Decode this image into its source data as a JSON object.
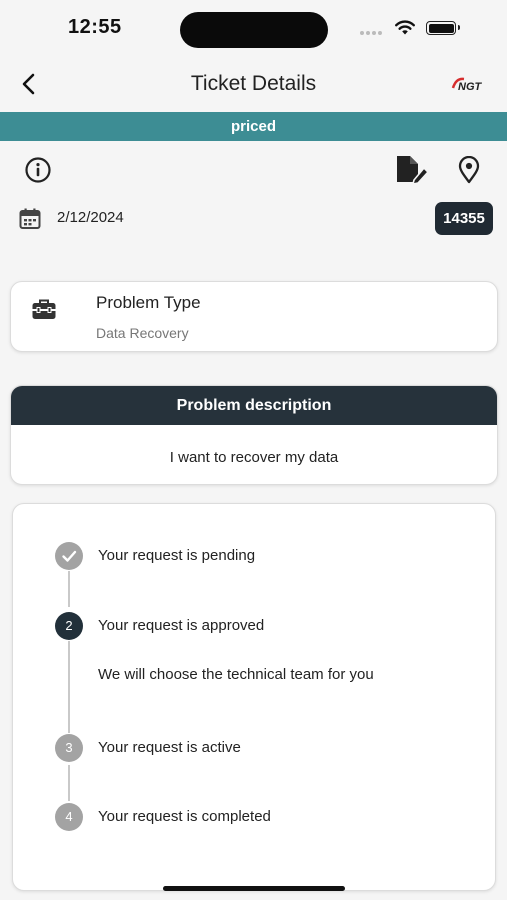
{
  "status_bar": {
    "time": "12:55"
  },
  "nav": {
    "title": "Ticket Details",
    "logo_text": "NGT"
  },
  "status_banner": {
    "text": "priced",
    "color": "#3d8d94"
  },
  "ticket": {
    "date": "2/12/2024",
    "number": "14355"
  },
  "problem_type": {
    "title": "Problem Type",
    "value": "Data Recovery"
  },
  "description": {
    "header": "Problem description",
    "text": "I want to recover my data"
  },
  "timeline": {
    "steps": [
      {
        "marker": "",
        "label": "Your request is pending",
        "state": "done"
      },
      {
        "marker": "2",
        "label": "Your request is approved",
        "state": "current",
        "note": "We will choose the technical team for you"
      },
      {
        "marker": "3",
        "label": "Your request is active",
        "state": "upcoming"
      },
      {
        "marker": "4",
        "label": "Your request is completed",
        "state": "upcoming"
      }
    ]
  },
  "colors": {
    "accent": "#3d8d94",
    "dark": "#22303a",
    "muted": "#a3a3a3"
  },
  "icons": [
    "back-chevron-icon",
    "info-icon",
    "edit-document-icon",
    "location-pin-icon",
    "calendar-icon",
    "toolbox-icon",
    "checkmark-icon"
  ]
}
